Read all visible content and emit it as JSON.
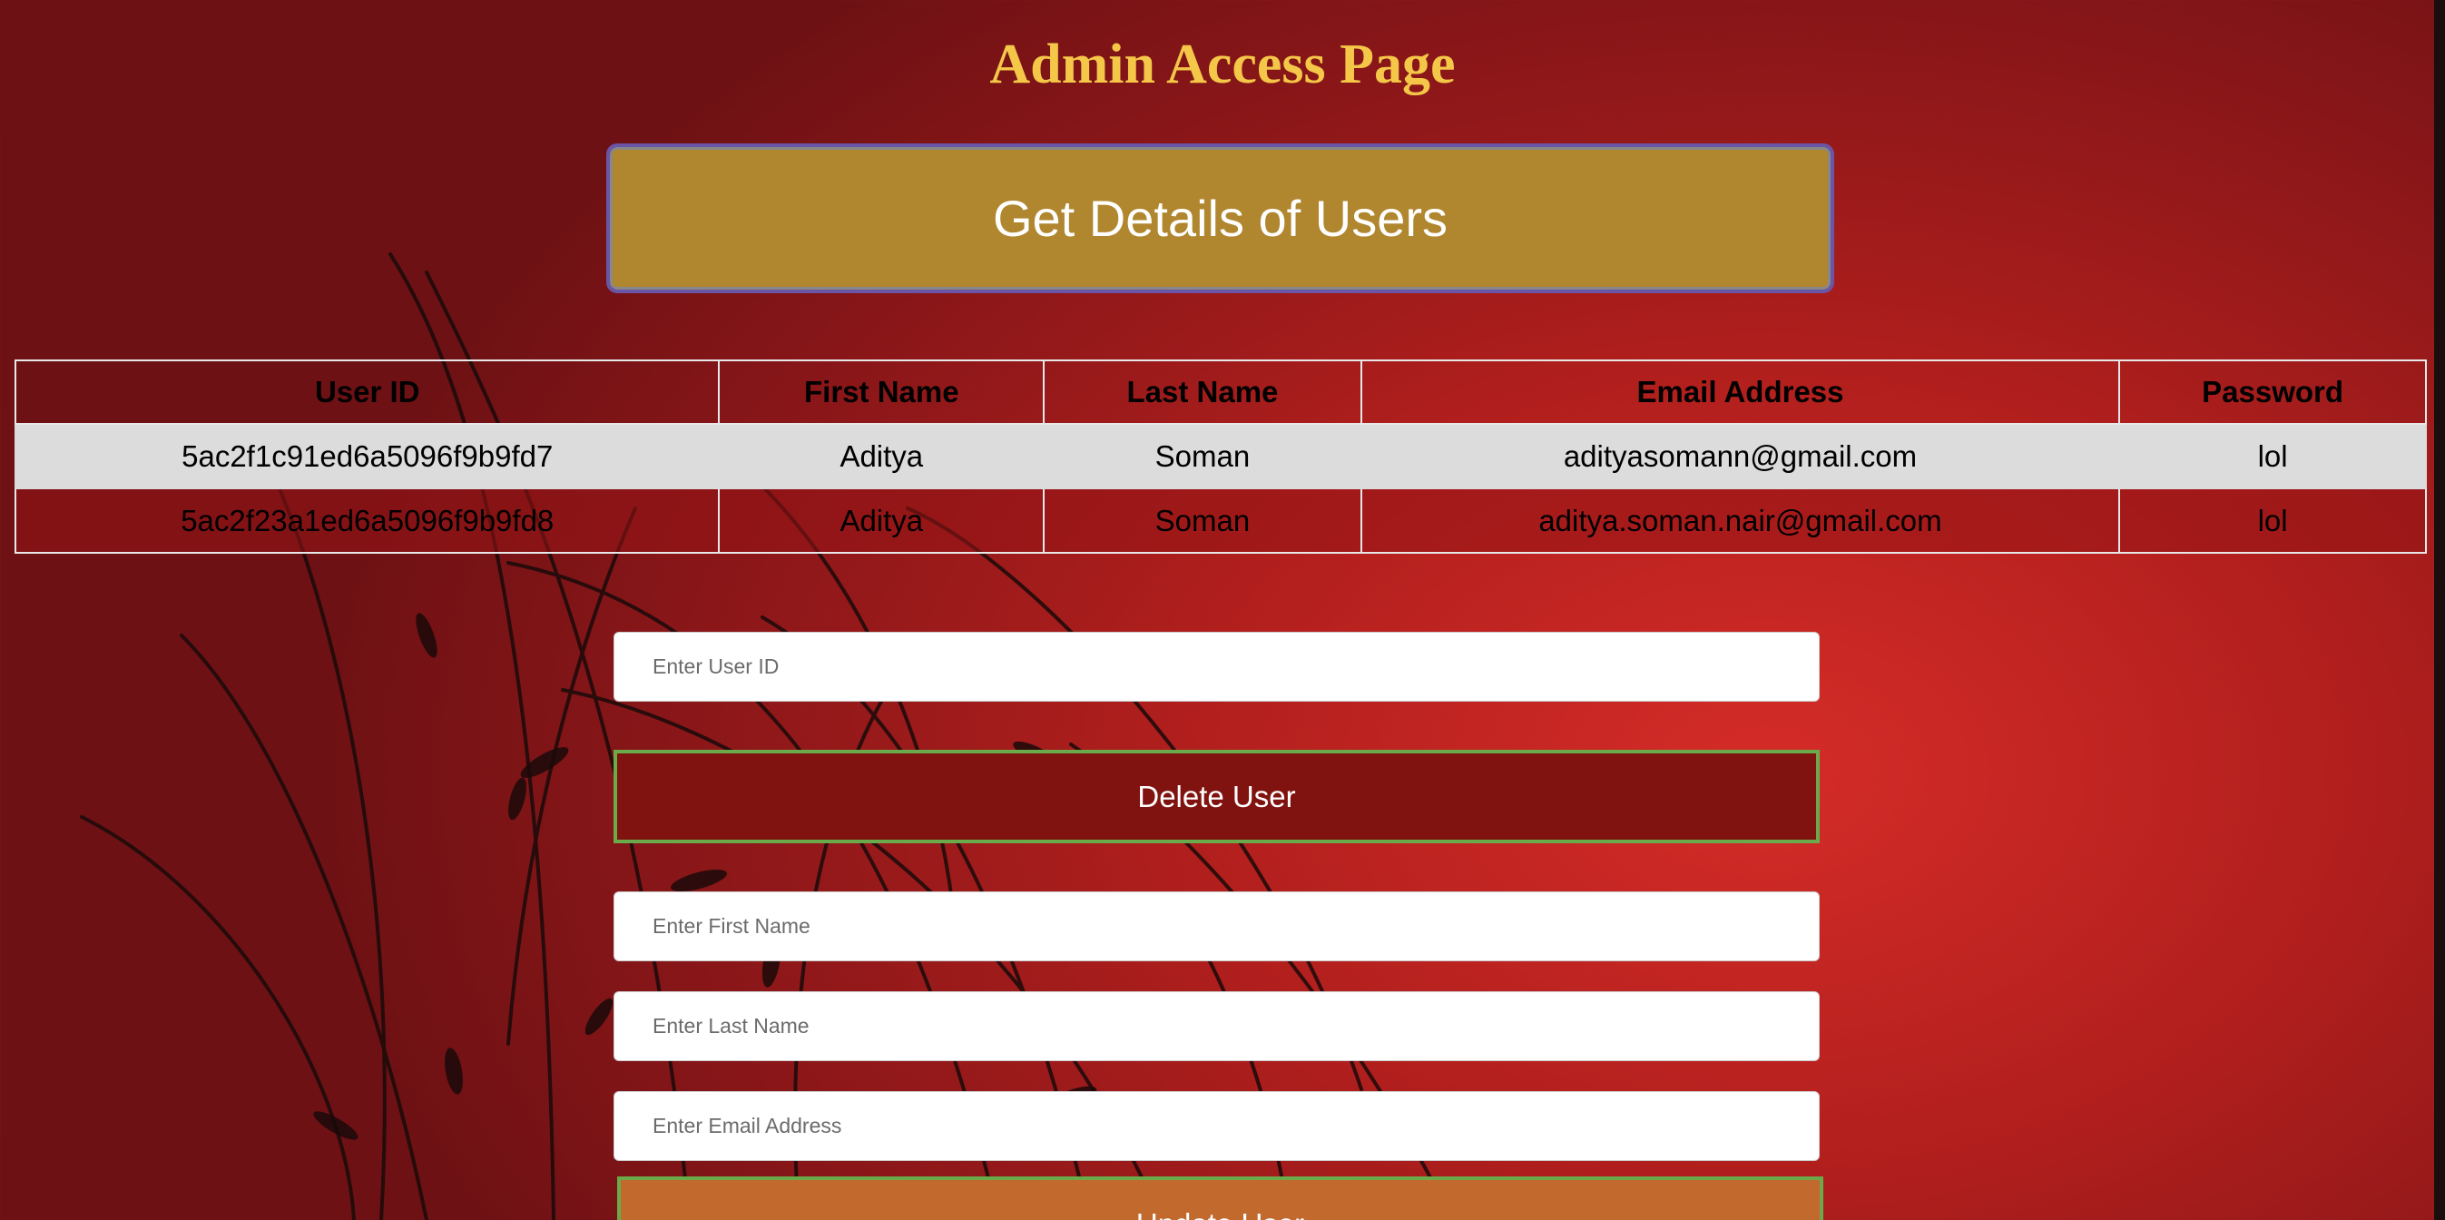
{
  "page": {
    "title": "Admin Access Page"
  },
  "actions": {
    "get_details_label": "Get Details of Users",
    "delete_label": "Delete User",
    "update_label": "Update User"
  },
  "table": {
    "headers": [
      "User ID",
      "First Name",
      "Last Name",
      "Email Address",
      "Password"
    ],
    "rows": [
      [
        "5ac2f1c91ed6a5096f9b9fd7",
        "Aditya",
        "Soman",
        "adityasomann@gmail.com",
        "lol"
      ],
      [
        "5ac2f23a1ed6a5096f9b9fd8",
        "Aditya",
        "Soman",
        "aditya.soman.nair@gmail.com",
        "lol"
      ]
    ]
  },
  "form": {
    "user_id_placeholder": "Enter User ID",
    "first_name_placeholder": "Enter First Name",
    "last_name_placeholder": "Enter Last Name",
    "email_placeholder": "Enter Email Address"
  },
  "colors": {
    "title": "#f5c748",
    "get_details_button": "#b0862f",
    "delete_button": "#80130f",
    "update_button": "#c2692e",
    "button_border": "#6aaa4a"
  }
}
